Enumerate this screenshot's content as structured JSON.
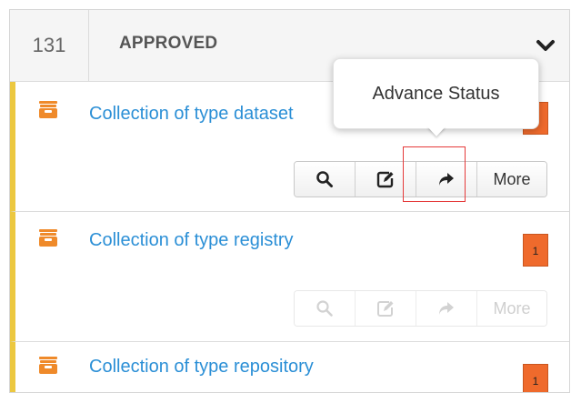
{
  "group": {
    "count": "131",
    "status_label": "APPROVED",
    "collapse_icon": "chevron-down-icon"
  },
  "items": [
    {
      "title": "Collection of type dataset",
      "badge": "",
      "icon": "collection-icon"
    },
    {
      "title": "Collection of type registry",
      "badge": "1",
      "icon": "collection-icon"
    },
    {
      "title": "Collection of type repository",
      "badge": "1",
      "icon": "collection-icon"
    }
  ],
  "actions": {
    "view_icon": "search-icon",
    "edit_icon": "edit-icon",
    "advance_icon": "share-arrow-icon",
    "more_label": "More"
  },
  "tooltip": {
    "text": "Advance Status"
  },
  "colors": {
    "accent_stripe": "#ecc840",
    "badge": "#ef6a2c",
    "link": "#2b8fd6",
    "highlight": "#e53a3a"
  }
}
